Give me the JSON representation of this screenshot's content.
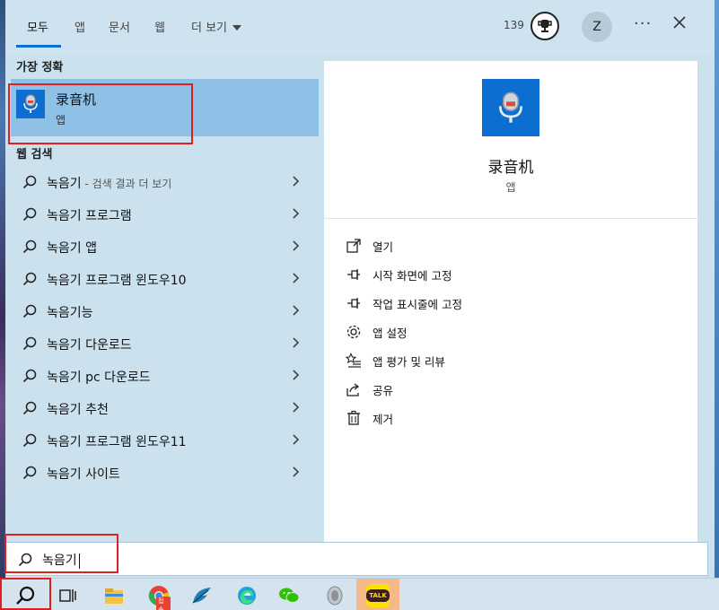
{
  "tabs": [
    {
      "label": "모두",
      "active": true
    },
    {
      "label": "앱"
    },
    {
      "label": "문서"
    },
    {
      "label": "웹"
    },
    {
      "label": "더 보기"
    }
  ],
  "header": {
    "points": "139",
    "avatar_letter": "Z"
  },
  "best_match": {
    "section_title": "가장 정확",
    "name": "录音机",
    "type": "앱",
    "icon": "microphone-icon"
  },
  "web": {
    "section_title": "웹 검색",
    "items": [
      {
        "label": "녹음기",
        "suffix": " - 검색 결과 더 보기"
      },
      {
        "label": "녹음기 프로그램"
      },
      {
        "label": "녹음기 앱"
      },
      {
        "label": "녹음기 프로그램 윈도우10"
      },
      {
        "label": "녹음기능"
      },
      {
        "label": "녹음기 다운로드"
      },
      {
        "label": "녹음기 pc 다운로드"
      },
      {
        "label": "녹음기 추천"
      },
      {
        "label": "녹음기 프로그램 윈도우11"
      },
      {
        "label": "녹음기 사이트"
      }
    ]
  },
  "detail": {
    "name": "录音机",
    "type": "앱",
    "actions": [
      {
        "label": "열기",
        "icon": "open-icon"
      },
      {
        "label": "시작 화면에 고정",
        "icon": "pin-icon"
      },
      {
        "label": "작업 표시줄에 고정",
        "icon": "pin-icon"
      },
      {
        "label": "앱 설정",
        "icon": "gear-icon"
      },
      {
        "label": "앱 평가 및 리뷰",
        "icon": "star-list-icon"
      },
      {
        "label": "공유",
        "icon": "share-icon"
      },
      {
        "label": "제거",
        "icon": "trash-icon"
      }
    ]
  },
  "search": {
    "value": "녹음기"
  },
  "taskbar": {
    "kakao_label": "TALK",
    "chrome_badge": "접속"
  },
  "colors": {
    "accent": "#0a6fcf",
    "highlight": "#8fc0e6",
    "annotation": "#e0201e"
  }
}
